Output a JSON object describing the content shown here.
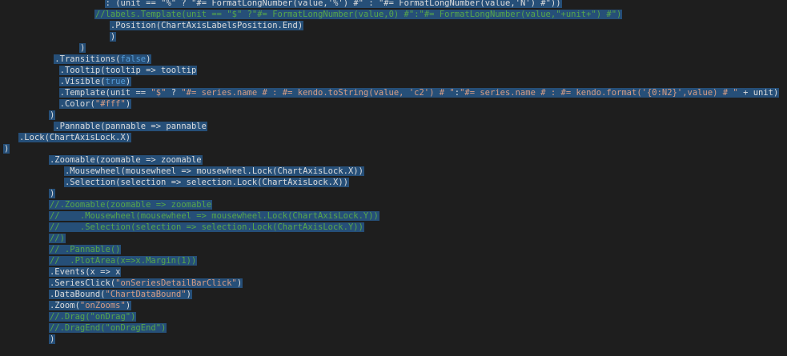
{
  "editor": {
    "lines": [
      {
        "indent": 20,
        "tokens": [
          {
            "text": ": (unit == \"%\" ? \"#= FormatLongNumber(value,'%') #\" : \"#= FormatLongNumber(value,'N') #\"))",
            "type": "plain"
          }
        ]
      },
      {
        "indent": 18,
        "tokens": [
          {
            "text": "//labels.Template(unit == \"$\" ?\"#= FormatLongNumber(value,0) #\":\"#= FormatLongNumber(value,\"+unit+\") #\")",
            "type": "cmt"
          }
        ]
      },
      {
        "indent": 21,
        "tokens": [
          {
            "text": ".Position(ChartAxisLabelsPosition.End)",
            "type": "plain"
          }
        ]
      },
      {
        "indent": 21,
        "tokens": [
          {
            "text": ")",
            "type": "plain"
          }
        ]
      },
      {
        "indent": 15,
        "tokens": [
          {
            "text": ")",
            "type": "plain"
          }
        ]
      },
      {
        "indent": 10,
        "tokens": [
          {
            "text": ".Transitions(",
            "type": "plain"
          },
          {
            "text": "false",
            "type": "kw"
          },
          {
            "text": ")",
            "type": "plain"
          }
        ]
      },
      {
        "indent": 11,
        "tokens": [
          {
            "text": ".Tooltip(tooltip => tooltip",
            "type": "plain"
          }
        ]
      },
      {
        "indent": 11,
        "tokens": [
          {
            "text": ".Visible(",
            "type": "plain"
          },
          {
            "text": "true",
            "type": "kw"
          },
          {
            "text": ")",
            "type": "plain"
          }
        ]
      },
      {
        "indent": 11,
        "tokens": [
          {
            "text": ".Template(unit == ",
            "type": "plain"
          },
          {
            "text": "\"$\"",
            "type": "str"
          },
          {
            "text": " ? ",
            "type": "plain"
          },
          {
            "text": "\"#= series.name # : #= kendo.toString(value, 'c2') # \"",
            "type": "str"
          },
          {
            "text": ":",
            "type": "plain"
          },
          {
            "text": "\"#= series.name # : #= kendo.format('{0:N2}',value) # \"",
            "type": "str"
          },
          {
            "text": " + unit)",
            "type": "plain"
          }
        ]
      },
      {
        "indent": 11,
        "tokens": [
          {
            "text": ".Color(",
            "type": "plain"
          },
          {
            "text": "\"#fff\"",
            "type": "str"
          },
          {
            "text": ")",
            "type": "plain"
          }
        ]
      },
      {
        "indent": 9,
        "tokens": [
          {
            "text": ")",
            "type": "plain"
          }
        ]
      },
      {
        "indent": 10,
        "tokens": [
          {
            "text": ".Pannable(pannable => pannable",
            "type": "plain"
          }
        ]
      },
      {
        "indent": 3,
        "tokens": [
          {
            "text": ".Lock(ChartAxisLock.X)",
            "type": "plain"
          }
        ]
      },
      {
        "indent": 0,
        "tokens": [
          {
            "text": ")",
            "type": "plain"
          }
        ]
      },
      {
        "indent": 9,
        "tokens": [
          {
            "text": ".Zoomable(zoomable => zoomable",
            "type": "plain"
          }
        ]
      },
      {
        "indent": 12,
        "tokens": [
          {
            "text": ".Mousewheel(mousewheel => mousewheel.Lock(ChartAxisLock.X))",
            "type": "plain"
          }
        ]
      },
      {
        "indent": 12,
        "tokens": [
          {
            "text": ".Selection(selection => selection.Lock(ChartAxisLock.X))",
            "type": "plain"
          }
        ]
      },
      {
        "indent": 9,
        "tokens": [
          {
            "text": ")",
            "type": "plain"
          }
        ]
      },
      {
        "indent": 9,
        "tokens": [
          {
            "text": "//.Zoomable(zoomable => zoomable",
            "type": "cmt"
          }
        ]
      },
      {
        "indent": 9,
        "tokens": [
          {
            "text": "//    .Mousewheel(mousewheel => mousewheel.Lock(ChartAxisLock.Y))",
            "type": "cmt"
          }
        ]
      },
      {
        "indent": 9,
        "tokens": [
          {
            "text": "//    .Selection(selection => selection.Lock(ChartAxisLock.Y))",
            "type": "cmt"
          }
        ]
      },
      {
        "indent": 9,
        "tokens": [
          {
            "text": "//)",
            "type": "cmt"
          }
        ]
      },
      {
        "indent": 9,
        "tokens": [
          {
            "text": "// .Pannable()",
            "type": "cmt"
          }
        ]
      },
      {
        "indent": 9,
        "tokens": [
          {
            "text": "//  .PlotArea(x=>x.Margin(1))",
            "type": "cmt"
          }
        ]
      },
      {
        "indent": 9,
        "tokens": [
          {
            "text": ".Events(x => x",
            "type": "plain"
          }
        ]
      },
      {
        "indent": 9,
        "tokens": [
          {
            "text": ".SeriesClick(",
            "type": "plain"
          },
          {
            "text": "\"onSeriesDetailBarClick\"",
            "type": "str"
          },
          {
            "text": ")",
            "type": "plain"
          }
        ]
      },
      {
        "indent": 9,
        "tokens": [
          {
            "text": ".DataBound(",
            "type": "plain"
          },
          {
            "text": "\"ChartDataBound\"",
            "type": "str"
          },
          {
            "text": ")",
            "type": "plain"
          }
        ]
      },
      {
        "indent": 9,
        "tokens": [
          {
            "text": ".Zoom(",
            "type": "plain"
          },
          {
            "text": "\"onZooms\"",
            "type": "str"
          },
          {
            "text": ")",
            "type": "plain"
          }
        ]
      },
      {
        "indent": 9,
        "tokens": [
          {
            "text": "//.Drag(\"onDrag\")",
            "type": "cmt"
          }
        ]
      },
      {
        "indent": 9,
        "tokens": [
          {
            "text": "//.DragEnd(\"onDragEnd\")",
            "type": "cmt"
          }
        ]
      },
      {
        "indent": 9,
        "tokens": [
          {
            "text": ")",
            "type": "plain"
          }
        ]
      }
    ]
  },
  "colors": {
    "background": "#1e1e1e",
    "selection": "#264f78",
    "plain": "#dcdcdc",
    "string": "#d69d85",
    "keyword": "#569cd6",
    "comment": "#57a64a"
  }
}
